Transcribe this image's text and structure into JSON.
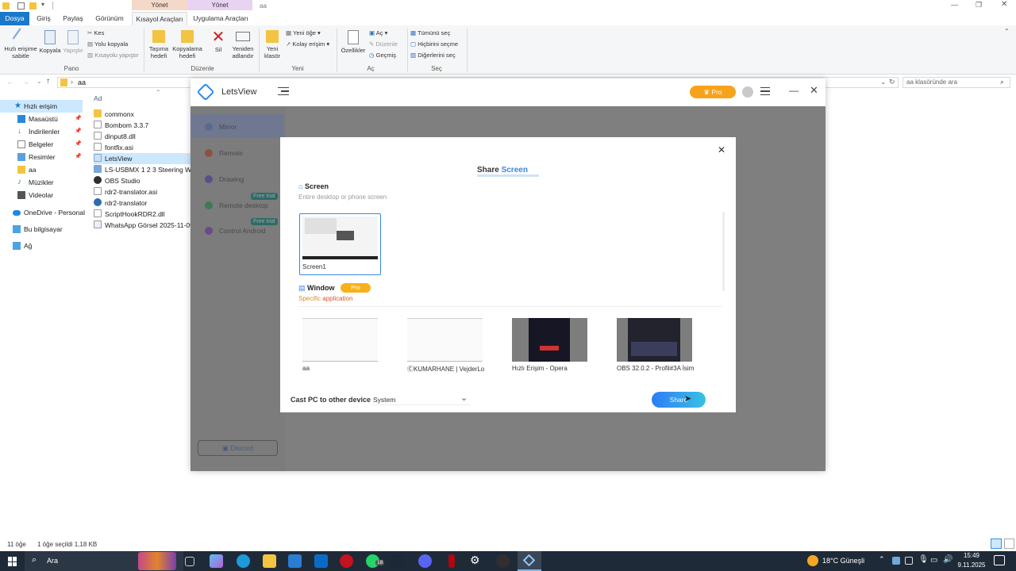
{
  "explorer": {
    "context_tabs": {
      "manage1": "Yönet",
      "manage2": "Yönet"
    },
    "window_name": "aa",
    "tabs": [
      "Dosya",
      "Giriş",
      "Paylaş",
      "Görünüm",
      "Kısayol Araçları",
      "Uygulama Araçları"
    ],
    "ribbon": {
      "pin": "Hızlı erişime sabitle",
      "copy": "Kopyala",
      "paste": "Yapıştır",
      "cut": "Kes",
      "copy_path": "Yolu kopyala",
      "paste_shortcut": "Kısayolu yapıştır",
      "group_clipboard": "Pano",
      "move_to": "Taşıma hedefi",
      "copy_to": "Kopyalama hedefi",
      "delete": "Sil",
      "rename": "Yeniden adlandır",
      "group_organize": "Düzenle",
      "new_folder": "Yeni klasör",
      "new_item": "Yeni öğe",
      "easy_access": "Kolay erişim",
      "group_new": "Yeni",
      "properties": "Özellikler",
      "open": "Aç",
      "edit": "Düzenle",
      "history": "Geçmiş",
      "group_open": "Aç",
      "select_all": "Tümünü seç",
      "select_none": "Hiçbirini seçme",
      "invert": "Diğerlerini seç",
      "group_select": "Seç"
    },
    "address": "aa",
    "search_placeholder": "aa klasöründe ara",
    "column_name": "Ad",
    "nav": [
      "Hızlı erişim",
      "Masaüstü",
      "İndirilenler",
      "Belgeler",
      "Resimler",
      "aa",
      "Müzikler",
      "Videolar",
      "OneDrive - Personal",
      "Bu bilgisayar",
      "Ağ"
    ],
    "files": [
      "commonx",
      "Bombom 3.3.7",
      "dinput8.dll",
      "fontfix.asi",
      "LetsView",
      "LS-USBMX 1 2 3 Steering Wheel",
      "OBS Studio",
      "rdr2-translator.asi",
      "rdr2-translator",
      "ScriptHookRDR2.dll",
      "WhatsApp Görsel 2025-11-09 saat"
    ],
    "status_count": "11 öğe",
    "status_selected": "1 öğe seçildi  1,18 KB"
  },
  "letsview": {
    "app_name": "LetsView",
    "pro_label": "Pro",
    "menu": [
      "Mirror",
      "Remote",
      "Drawing",
      "Remote desktop",
      "Control Android"
    ],
    "free_trial": "Free trial",
    "discord": "Discord",
    "dialog": {
      "title_a": "Share",
      "title_b": "Screen",
      "screen_heading": "Screen",
      "screen_desc": "Entire desktop or phone screen",
      "screen_thumb_label": "Screen1",
      "window_heading": "Window",
      "window_pro": "Pro",
      "window_desc_a": "Specific",
      "window_desc_b": "application",
      "windows": [
        "aa",
        "ⒸKUMARHANE | VejderLo",
        "Hızlı Erişim - Opera",
        "OBS 32.0.2 - Profil#3A İsim"
      ],
      "cast_label": "Cast PC to other device",
      "cast_value": "System",
      "share_button": "Share"
    }
  },
  "taskbar": {
    "search": "Ara",
    "weather": "18°C  Güneşli",
    "time": "15:49",
    "date": "9.11.2025",
    "badge": "18"
  }
}
